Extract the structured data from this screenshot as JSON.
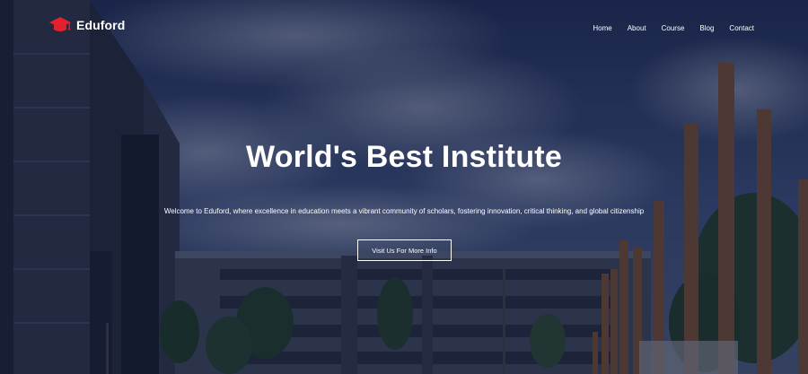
{
  "brand": {
    "name": "Eduford",
    "icon": "graduation-cap-icon",
    "icon_color": "#e3222e"
  },
  "nav": {
    "items": [
      {
        "label": "Home"
      },
      {
        "label": "About"
      },
      {
        "label": "Course"
      },
      {
        "label": "Blog"
      },
      {
        "label": "Contact"
      }
    ]
  },
  "hero": {
    "title": "World's Best Institute",
    "subtitle": "Welcome to Eduford, where excellence in education meets a vibrant community of scholars, fostering innovation, critical thinking, and global citizenship",
    "cta_label": "Visit Us For More Info"
  },
  "colors": {
    "text": "#ffffff",
    "overlay": "#101834",
    "sky": "#2a3c66"
  }
}
